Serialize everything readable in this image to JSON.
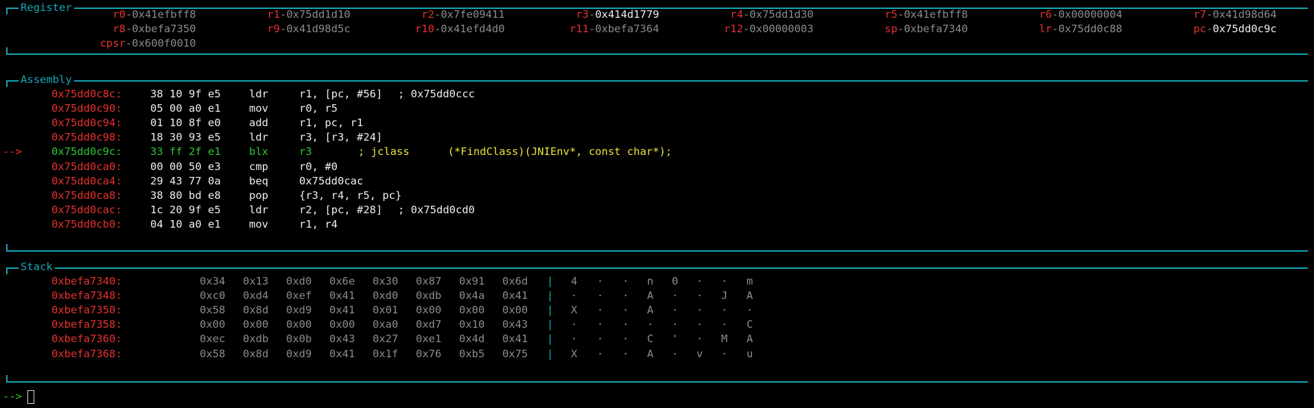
{
  "register": {
    "title": "Register",
    "rows": [
      [
        {
          "name": "r0",
          "value": "0x41efbff8",
          "changed": false
        },
        {
          "name": "r1",
          "value": "0x75dd1d10",
          "changed": false
        },
        {
          "name": "r2",
          "value": "0x7fe09411",
          "changed": false
        },
        {
          "name": "r3",
          "value": "0x414d1779",
          "changed": true
        },
        {
          "name": "r4",
          "value": "0x75dd1d30",
          "changed": false
        },
        {
          "name": "r5",
          "value": "0x41efbff8",
          "changed": false
        },
        {
          "name": "r6",
          "value": "0x00000004",
          "changed": false
        },
        {
          "name": "r7",
          "value": "0x41d98d64",
          "changed": false
        }
      ],
      [
        {
          "name": "r8",
          "value": "0xbefa7350",
          "changed": false
        },
        {
          "name": "r9",
          "value": "0x41d98d5c",
          "changed": false
        },
        {
          "name": "r10",
          "value": "0x41efd4d0",
          "changed": false
        },
        {
          "name": "r11",
          "value": "0xbefa7364",
          "changed": false
        },
        {
          "name": "r12",
          "value": "0x00000003",
          "changed": false
        },
        {
          "name": "sp",
          "value": "0xbefa7340",
          "changed": false
        },
        {
          "name": "lr",
          "value": "0x75dd0c88",
          "changed": false
        },
        {
          "name": "pc",
          "value": "0x75dd0c9c",
          "changed": true
        }
      ],
      [
        {
          "name": "cpsr",
          "value": "0x600f0010",
          "changed": false
        }
      ]
    ]
  },
  "assembly": {
    "title": "Assembly",
    "marker": "-->",
    "rows": [
      {
        "addr": "0x75dd0c8c:",
        "bytes": "38 10 9f e5",
        "mnem": "ldr",
        "ops": "r1, [pc, #56]",
        "comment": "; 0x75dd0ccc",
        "current": false
      },
      {
        "addr": "0x75dd0c90:",
        "bytes": "05 00 a0 e1",
        "mnem": "mov",
        "ops": "r0, r5",
        "comment": "",
        "current": false
      },
      {
        "addr": "0x75dd0c94:",
        "bytes": "01 10 8f e0",
        "mnem": "add",
        "ops": "r1, pc, r1",
        "comment": "",
        "current": false
      },
      {
        "addr": "0x75dd0c98:",
        "bytes": "18 30 93 e5",
        "mnem": "ldr",
        "ops": "r3, [r3, #24]",
        "comment": "",
        "current": false
      },
      {
        "addr": "0x75dd0c9c:",
        "bytes": "33 ff 2f e1",
        "mnem": "blx",
        "ops": "r3",
        "comment": "; jclass      (*FindClass)(JNIEnv*, const char*);",
        "current": true
      },
      {
        "addr": "0x75dd0ca0:",
        "bytes": "00 00 50 e3",
        "mnem": "cmp",
        "ops": "r0, #0",
        "comment": "",
        "current": false
      },
      {
        "addr": "0x75dd0ca4:",
        "bytes": "29 43 77 0a",
        "mnem": "beq",
        "ops": "0x75dd0cac",
        "comment": "",
        "current": false
      },
      {
        "addr": "0x75dd0ca8:",
        "bytes": "38 80 bd e8",
        "mnem": "pop",
        "ops": "{r3, r4, r5, pc}",
        "comment": "",
        "current": false
      },
      {
        "addr": "0x75dd0cac:",
        "bytes": "1c 20 9f e5",
        "mnem": "ldr",
        "ops": "r2, [pc, #28]",
        "comment": "; 0x75dd0cd0",
        "current": false
      },
      {
        "addr": "0x75dd0cb0:",
        "bytes": "04 10 a0 e1",
        "mnem": "mov",
        "ops": "r1, r4",
        "comment": "",
        "current": false
      }
    ]
  },
  "stack": {
    "title": "Stack",
    "separator": "|",
    "rows": [
      {
        "addr": "0xbefa7340:",
        "bytes": [
          "0x34",
          "0x13",
          "0xd0",
          "0x6e",
          "0x30",
          "0x87",
          "0x91",
          "0x6d"
        ],
        "ascii": [
          "4",
          "·",
          "·",
          "n",
          "0",
          "·",
          "·",
          "m"
        ]
      },
      {
        "addr": "0xbefa7348:",
        "bytes": [
          "0xc0",
          "0xd4",
          "0xef",
          "0x41",
          "0xd0",
          "0xdb",
          "0x4a",
          "0x41"
        ],
        "ascii": [
          "·",
          "·",
          "·",
          "A",
          "·",
          "·",
          "J",
          "A"
        ]
      },
      {
        "addr": "0xbefa7350:",
        "bytes": [
          "0x58",
          "0x8d",
          "0xd9",
          "0x41",
          "0x01",
          "0x00",
          "0x00",
          "0x00"
        ],
        "ascii": [
          "X",
          "·",
          "·",
          "A",
          "·",
          "·",
          "·",
          "·"
        ]
      },
      {
        "addr": "0xbefa7358:",
        "bytes": [
          "0x00",
          "0x00",
          "0x00",
          "0x00",
          "0xa0",
          "0xd7",
          "0x10",
          "0x43"
        ],
        "ascii": [
          "·",
          "·",
          "·",
          "·",
          "·",
          "·",
          "·",
          "C"
        ]
      },
      {
        "addr": "0xbefa7360:",
        "bytes": [
          "0xec",
          "0xdb",
          "0x0b",
          "0x43",
          "0x27",
          "0xe1",
          "0x4d",
          "0x41"
        ],
        "ascii": [
          "·",
          "·",
          "·",
          "C",
          "'",
          "·",
          "M",
          "A"
        ]
      },
      {
        "addr": "0xbefa7368:",
        "bytes": [
          "0x58",
          "0x8d",
          "0xd9",
          "0x41",
          "0x1f",
          "0x76",
          "0xb5",
          "0x75"
        ],
        "ascii": [
          "X",
          "·",
          "·",
          "A",
          "·",
          "v",
          "·",
          "u"
        ]
      }
    ]
  },
  "prompt": {
    "symbol": "-->",
    "input": ""
  },
  "colors": {
    "frame": "#15a8b4",
    "address": "#e8312f",
    "value": "#8c8c8c",
    "changed": "#f0f0f0",
    "current_line": "#32c734",
    "comment_highlight": "#e9e63a"
  }
}
